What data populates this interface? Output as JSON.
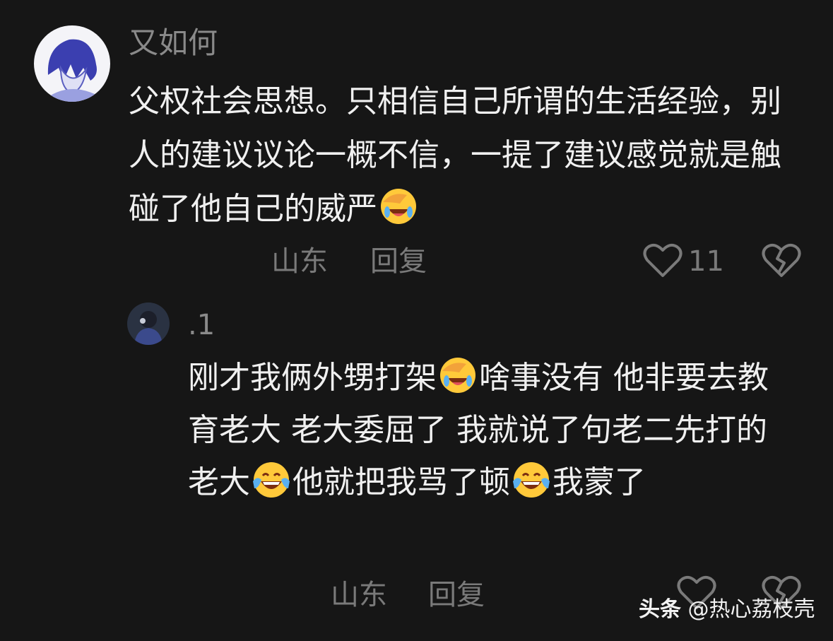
{
  "comment": {
    "username": "又如何",
    "text_part1": "父权社会思想。只相信自己所谓的生活经验，别人的建议议论一概不信，一提了建议感觉就是触碰了他自己的威严",
    "emoji_1": "facepalm-laugh-emoji",
    "location": "山东",
    "reply_label": "回复",
    "like_count": "11"
  },
  "reply": {
    "username": ".1",
    "text_part1": "刚才我俩外甥打架",
    "emoji_1": "facepalm-laugh-emoji",
    "text_part2": "啥事没有 他非要去教育老大 老大委屈了 我就说了句老二先打的老大",
    "emoji_2": "tears-of-joy-emoji",
    "text_part3": "他就把我骂了顿",
    "emoji_3": "tears-of-joy-emoji",
    "text_part4": "我蒙了",
    "location": "山东",
    "reply_label": "回复"
  },
  "watermark": {
    "brand": "头条",
    "account": "@热心荔枝壳"
  },
  "colors": {
    "background": "#161616",
    "text": "#f0f0f0",
    "muted": "#7a7a7a",
    "emoji_yellow": "#ffc93a"
  }
}
